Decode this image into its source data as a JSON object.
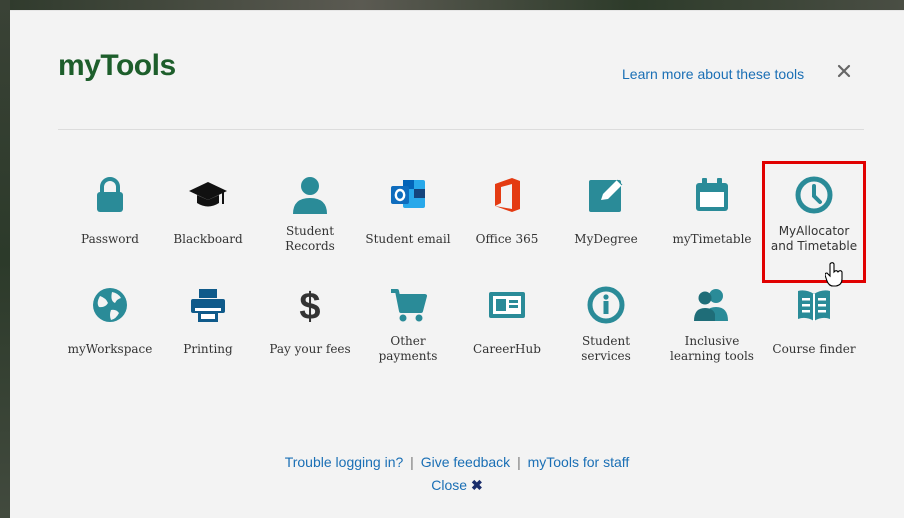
{
  "modal": {
    "title": "myTools",
    "learn_more": "Learn more about these tools",
    "close_icon": "close-icon"
  },
  "colors": {
    "brand": "#1d5e2b",
    "icon": "#2a8b98",
    "link": "#1a6fb5",
    "highlight": "#e00000",
    "office_red": "#e43b12",
    "outlook_blue": "#0f6cbd"
  },
  "tools": [
    {
      "label": "Password",
      "icon": "lock-icon"
    },
    {
      "label": "Blackboard",
      "icon": "graduation-cap-icon"
    },
    {
      "label": "Student Records",
      "icon": "user-icon"
    },
    {
      "label": "Student email",
      "icon": "outlook-icon"
    },
    {
      "label": "Office 365",
      "icon": "office-icon"
    },
    {
      "label": "MyDegree",
      "icon": "edit-icon"
    },
    {
      "label": "myTimetable",
      "icon": "calendar-icon"
    },
    {
      "label": "MyAllocator and Timetable",
      "icon": "clock-icon"
    },
    {
      "label": "myWorkspace",
      "icon": "globe-icon"
    },
    {
      "label": "Printing",
      "icon": "printer-icon"
    },
    {
      "label": "Pay your fees",
      "icon": "dollar-icon"
    },
    {
      "label": "Other payments",
      "icon": "cart-icon"
    },
    {
      "label": "CareerHub",
      "icon": "id-card-icon"
    },
    {
      "label": "Student services",
      "icon": "info-icon"
    },
    {
      "label": "Inclusive learning tools",
      "icon": "users-icon"
    },
    {
      "label": "Course finder",
      "icon": "book-icon"
    }
  ],
  "footer": {
    "trouble": "Trouble logging in?",
    "separator": "|",
    "feedback": "Give feedback",
    "staff": "myTools for staff",
    "close": "Close"
  }
}
